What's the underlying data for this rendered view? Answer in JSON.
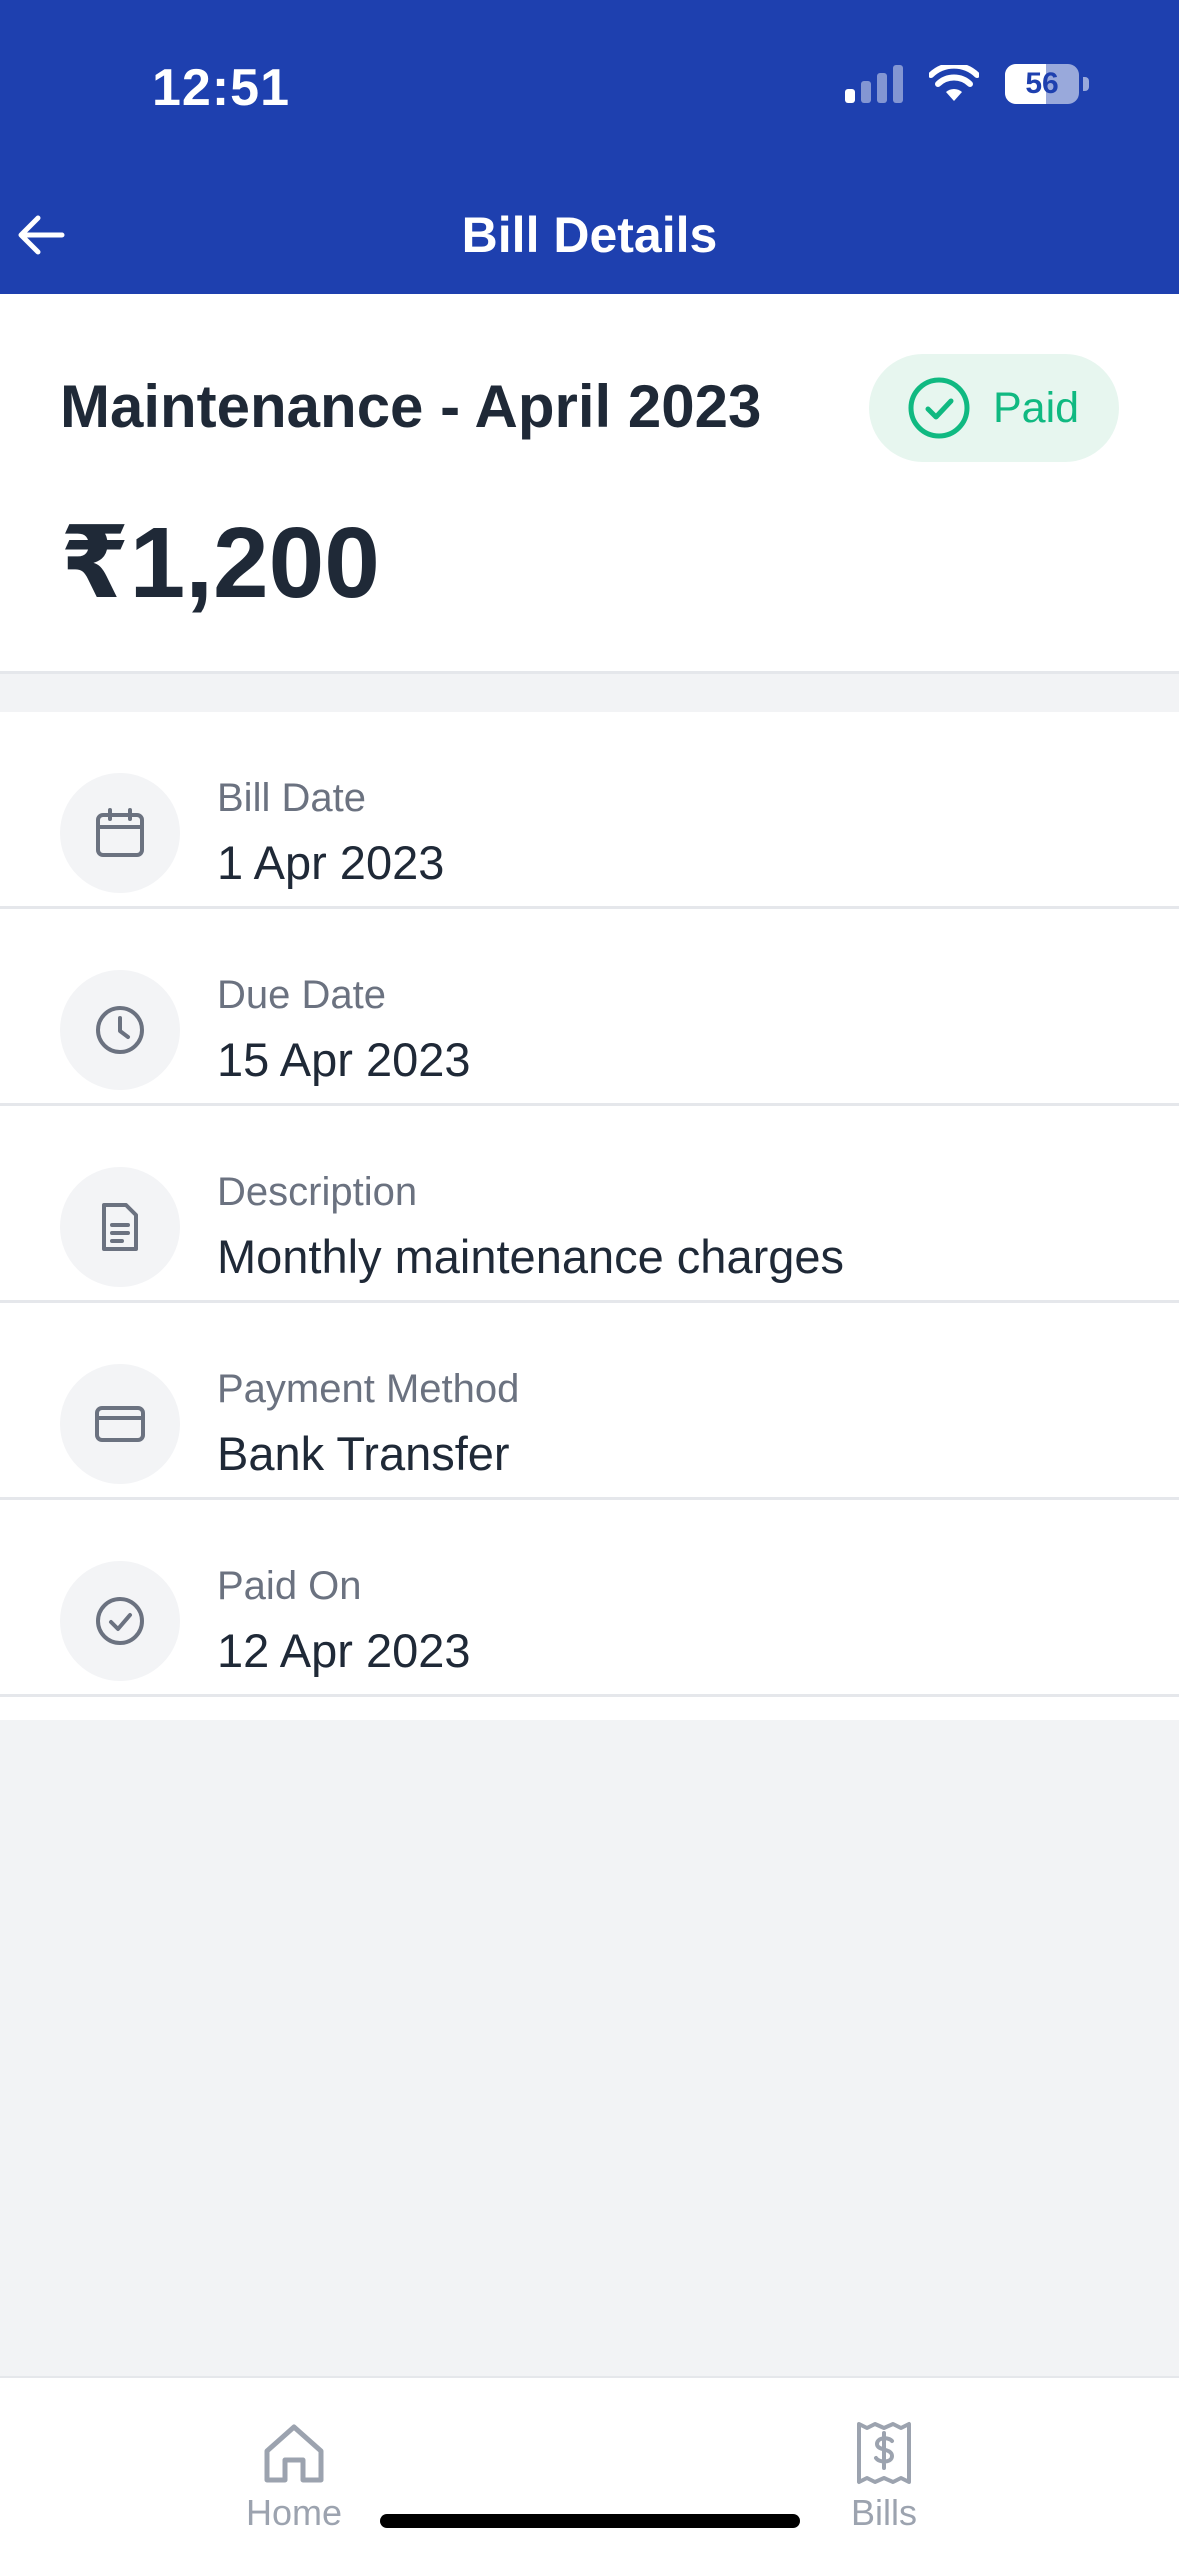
{
  "status_bar": {
    "time": "12:51",
    "battery": "56"
  },
  "header": {
    "title": "Bill Details",
    "back_icon": "arrow-left-icon"
  },
  "bill": {
    "title": "Maintenance - April 2023",
    "status": "Paid",
    "amount": "₹1,200"
  },
  "details": [
    {
      "icon": "calendar-icon",
      "label": "Bill Date",
      "value": "1 Apr 2023"
    },
    {
      "icon": "clock-icon",
      "label": "Due Date",
      "value": "15 Apr 2023"
    },
    {
      "icon": "document-icon",
      "label": "Description",
      "value": "Monthly maintenance charges"
    },
    {
      "icon": "credit-card-icon",
      "label": "Payment Method",
      "value": "Bank Transfer"
    },
    {
      "icon": "check-circle-icon",
      "label": "Paid On",
      "value": "12 Apr 2023"
    }
  ],
  "bottom_nav": [
    {
      "icon": "home-icon",
      "label": "Home"
    },
    {
      "icon": "bill-receipt-icon",
      "label": "Bills"
    }
  ],
  "colors": {
    "primary": "#1e40af",
    "success": "#10b981",
    "success_bg": "#e7f6ef"
  }
}
